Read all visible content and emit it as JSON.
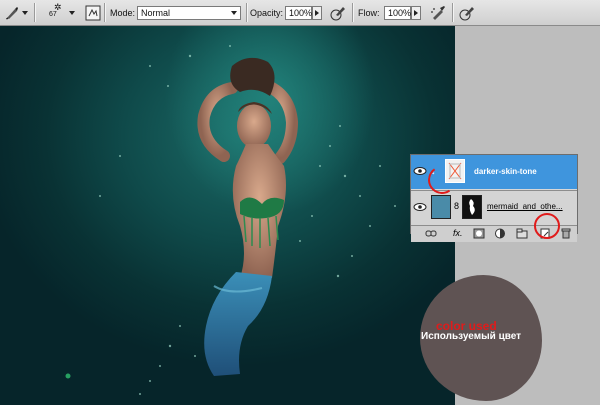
{
  "options_bar": {
    "brush_size": "67",
    "mode_label": "Mode:",
    "mode_value": "Normal",
    "opacity_label": "Opacity:",
    "opacity_value": "100%",
    "flow_label": "Flow:",
    "flow_value": "100%"
  },
  "layers_panel": {
    "layers": [
      {
        "name": "darker-skin-tone",
        "selected": true
      },
      {
        "name": "mermaid_and_othe...",
        "selected": false
      }
    ]
  },
  "annotation": {
    "color_used_en": "color used",
    "color_used_ru": "Используемый цвет",
    "swatch_color": "#5f5353"
  },
  "colors": {
    "highlight": "#3f95dd",
    "circle": "#e01b1b"
  }
}
